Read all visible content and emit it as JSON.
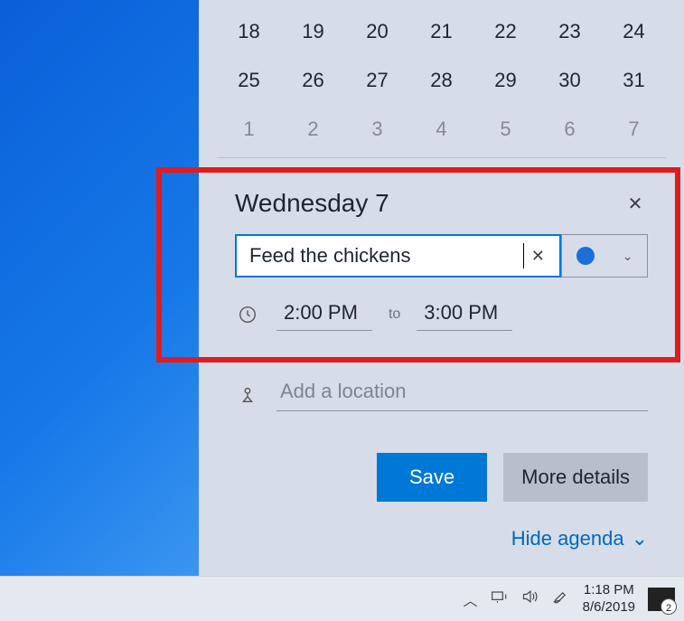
{
  "calendar": {
    "rows": [
      {
        "days": [
          {
            "n": "18"
          },
          {
            "n": "19"
          },
          {
            "n": "20"
          },
          {
            "n": "21"
          },
          {
            "n": "22"
          },
          {
            "n": "23"
          },
          {
            "n": "24"
          }
        ],
        "dim": false
      },
      {
        "days": [
          {
            "n": "25"
          },
          {
            "n": "26"
          },
          {
            "n": "27"
          },
          {
            "n": "28"
          },
          {
            "n": "29"
          },
          {
            "n": "30"
          },
          {
            "n": "31"
          }
        ],
        "dim": false
      },
      {
        "days": [
          {
            "n": "1"
          },
          {
            "n": "2"
          },
          {
            "n": "3"
          },
          {
            "n": "4"
          },
          {
            "n": "5"
          },
          {
            "n": "6"
          },
          {
            "n": "7"
          }
        ],
        "dim": true
      }
    ]
  },
  "event": {
    "day_label": "Wednesday 7",
    "name_value": "Feed the chickens",
    "clear_glyph": "✕",
    "close_glyph": "✕",
    "calendar_dropdown_color": "#1a6fd8",
    "start_time": "2:00 PM",
    "to_label": "to",
    "end_time": "3:00 PM",
    "location_placeholder": "Add a location",
    "save_label": "Save",
    "more_label": "More details",
    "hide_agenda_label": "Hide agenda"
  },
  "taskbar": {
    "tray_up_glyph": "︿",
    "time": "1:18 PM",
    "date": "8/6/2019",
    "notification_count": "2"
  }
}
